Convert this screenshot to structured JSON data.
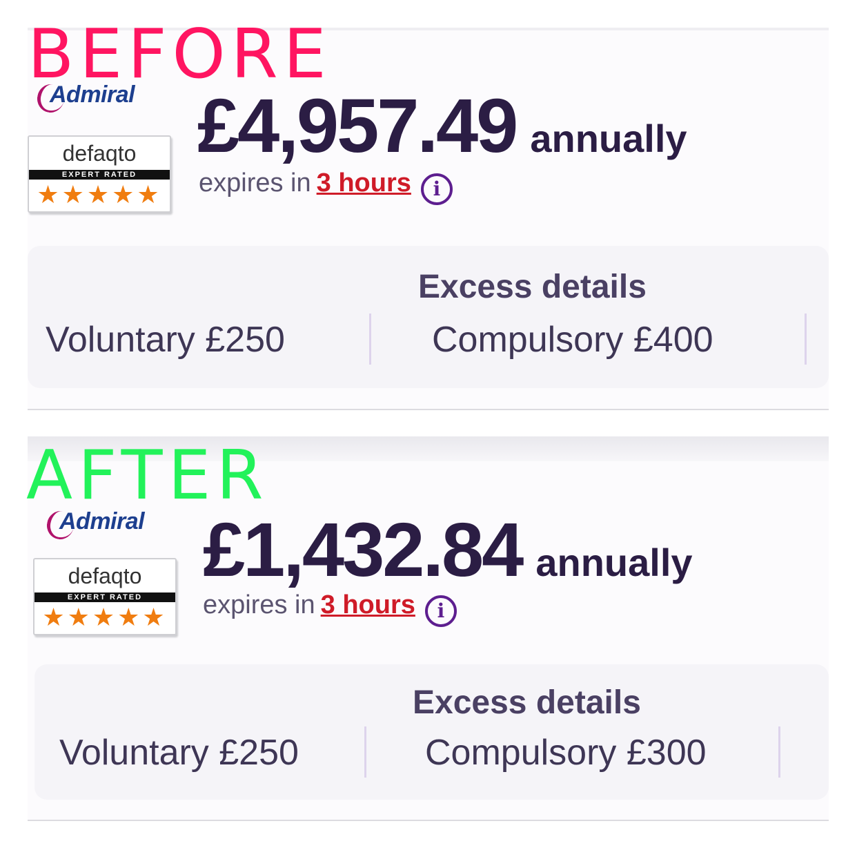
{
  "before": {
    "stamp": "BEFORE",
    "insurer": "Admiral",
    "rating_brand": "defaqto",
    "rating_label": "EXPERT RATED",
    "stars": "★★★★★",
    "star_count": 5,
    "price": "£4,957.49",
    "period": "annually",
    "expires_prefix": "expires in",
    "expires_value": "3 hours",
    "info_glyph": "i",
    "excess_title": "Excess details",
    "voluntary": "Voluntary £250",
    "compulsory": "Compulsory £400"
  },
  "after": {
    "stamp": "AFTER",
    "insurer": "Admiral",
    "rating_brand": "defaqto",
    "rating_label": "EXPERT RATED",
    "stars": "★★★★★",
    "star_count": 5,
    "price": "£1,432.84",
    "period": "annually",
    "expires_prefix": "expires in",
    "expires_value": "3 hours",
    "info_glyph": "i",
    "excess_title": "Excess details",
    "voluntary": "Voluntary £250",
    "compulsory": "Compulsory £300"
  },
  "colors": {
    "before_stamp": "#ff1561",
    "after_stamp": "#22f25a",
    "price_text": "#2b1d44",
    "expiry_highlight": "#cf1b28",
    "info_icon": "#5d1e8f",
    "stars": "#f07d10"
  }
}
